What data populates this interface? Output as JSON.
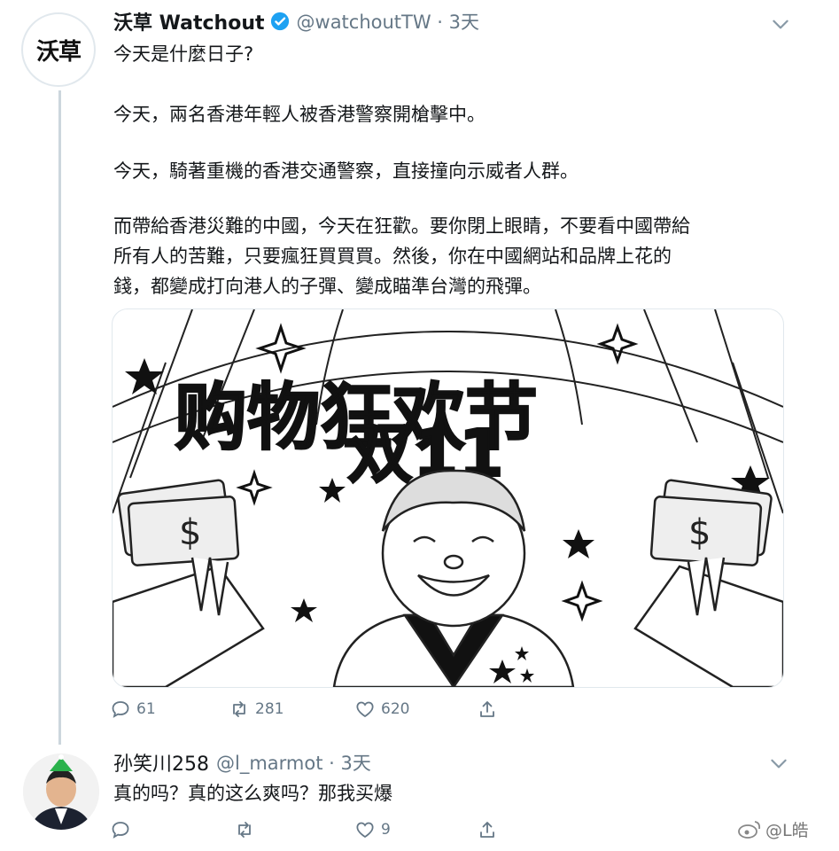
{
  "tweet1": {
    "avatar_text": "沃草",
    "display_name": "沃草 Watchout",
    "handle_time": "@watchoutTW · 3天",
    "paragraphs": [
      "今天是什麼日子?",
      "今天，兩名香港年輕人被香港警察開槍擊中。",
      "今天，騎著重機的香港交通警察，直接撞向示威者人群。",
      "而帶給香港災難的中國，今天在狂歡。要你閉上眼睛，不要看中國帶給",
      "所有人的苦難，只要瘋狂買買買。然後，你在中國網站和品牌上花的",
      "錢，都變成打向港人的子彈、變成瞄準台灣的飛彈。"
    ],
    "image": {
      "line1": "购物狂欢节",
      "line2": "双11"
    },
    "reply_count": "61",
    "retweet_count": "281",
    "like_count": "620"
  },
  "tweet2": {
    "display_name": "孙笑川258",
    "handle_time": "@l_marmot · 3天",
    "text": "真的吗？真的这么爽吗？那我买爆",
    "like_count": "9"
  },
  "watermark": "@L皓",
  "colors": {
    "text_primary": "#14171a",
    "text_secondary": "#657786",
    "verified_blue": "#1da1f2",
    "thread_line": "#ccd6dd"
  },
  "icons": [
    "reply-icon",
    "retweet-icon",
    "like-icon",
    "share-icon",
    "verified-badge-icon",
    "chevron-down-icon",
    "weibo-icon"
  ]
}
